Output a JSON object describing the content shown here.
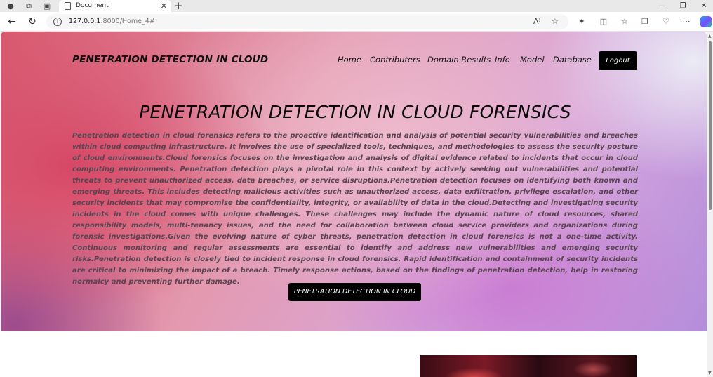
{
  "browser": {
    "tab_title": "Document",
    "url_host": "127.0.0.1",
    "url_rest": ":8000/Home_4#"
  },
  "icons": {
    "profile": "profile-icon",
    "workspaces": "workspaces-icon",
    "tab_actions": "tab-actions-icon",
    "back": "back-arrow-icon",
    "refresh": "refresh-icon",
    "info": "info-icon",
    "read_aloud": "read-aloud-icon",
    "favorite": "star-icon",
    "extensions": "extensions-icon",
    "split_screen": "split-screen-icon",
    "favorites": "favorites-icon",
    "collections": "collections-icon",
    "browser_essentials": "heart-pulse-icon",
    "more": "more-icon",
    "copilot": "copilot-icon"
  },
  "site": {
    "brand": "PENETRATION DETECTION IN CLOUD",
    "nav": [
      "Home",
      "Contributers",
      "Domain Results",
      "Info",
      "Model",
      "Database"
    ],
    "logout_label": "Logout"
  },
  "hero": {
    "title": "PENETRATION DETECTION IN CLOUD FORENSICS",
    "paragraph": "Penetration detection in cloud forensics refers to the proactive identification and analysis of potential security vulnerabilities and breaches within cloud computing infrastructure. It involves the use of specialized tools, techniques, and methodologies to assess the security posture of cloud environments.Cloud forensics focuses on the investigation and analysis of digital evidence related to incidents that occur in cloud computing environments. Penetration detection plays a pivotal role in this context by actively seeking out vulnerabilities and potential threats to prevent unauthorized access, data breaches, or service disruptions.Penetration detection focuses on identifying both known and emerging threats. This includes detecting malicious activities such as unauthorized access, data exfiltration, privilege escalation, and other security incidents that may compromise the confidentiality, integrity, or availability of data in the cloud.Detecting and investigating security incidents in the cloud comes with unique challenges. These challenges may include the dynamic nature of cloud resources, shared responsibility models, multi-tenancy issues, and the need for collaboration between cloud service providers and organizations during forensic investigations.Given the evolving nature of cyber threats, penetration detection in cloud forensics is not a one-time activity. Continuous monitoring and regular assessments are essential to identify and address new vulnerabilities and emerging security risks.Penetration detection is closely tied to incident response in cloud forensics. Rapid identification and containment of security incidents are critical to minimizing the impact of a breach. Timely response actions, based on the findings of penetration detection, help in restoring normalcy and preventing further damage.",
    "cta_label": "PENETRATION DETECTION IN CLOUD"
  }
}
